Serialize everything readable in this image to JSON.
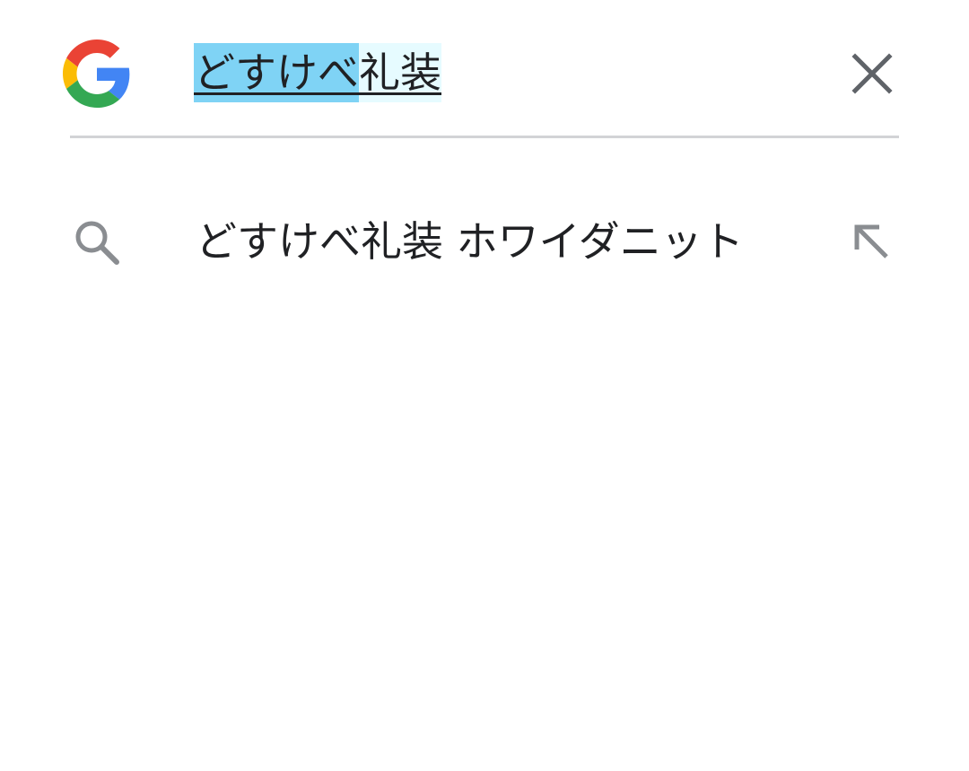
{
  "search": {
    "query_selected": "どすけべ",
    "query_rest": "礼装",
    "clear_icon": "close-icon",
    "logo_icon": "google-g-logo"
  },
  "suggestions": [
    {
      "text": "どすけべ礼装 ホワイダニット",
      "icon": "search-icon",
      "action_icon": "arrow-up-left-icon"
    }
  ],
  "colors": {
    "selection": "#7fd3f5",
    "composing": "#e6fbff",
    "divider": "#d2d3d6",
    "icon_gray": "#5f6368",
    "google_blue": "#4285F4",
    "google_red": "#EA4335",
    "google_yellow": "#FBBC05",
    "google_green": "#34A853"
  }
}
